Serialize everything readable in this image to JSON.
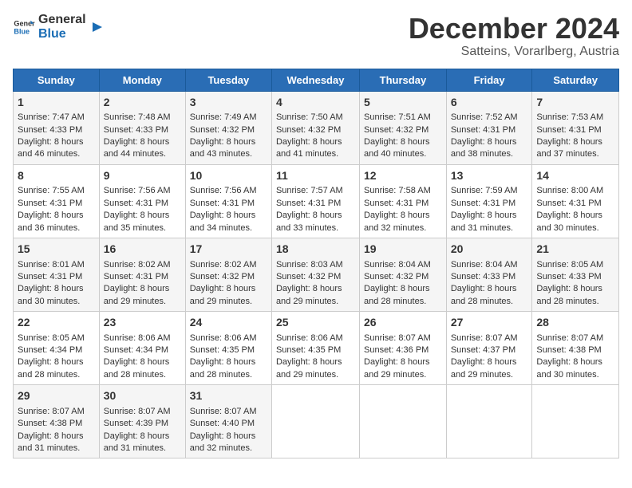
{
  "header": {
    "logo_general": "General",
    "logo_blue": "Blue",
    "month_title": "December 2024",
    "subtitle": "Satteins, Vorarlberg, Austria"
  },
  "days_of_week": [
    "Sunday",
    "Monday",
    "Tuesday",
    "Wednesday",
    "Thursday",
    "Friday",
    "Saturday"
  ],
  "weeks": [
    [
      {
        "day": "1",
        "sunrise": "Sunrise: 7:47 AM",
        "sunset": "Sunset: 4:33 PM",
        "daylight": "Daylight: 8 hours and 46 minutes."
      },
      {
        "day": "2",
        "sunrise": "Sunrise: 7:48 AM",
        "sunset": "Sunset: 4:33 PM",
        "daylight": "Daylight: 8 hours and 44 minutes."
      },
      {
        "day": "3",
        "sunrise": "Sunrise: 7:49 AM",
        "sunset": "Sunset: 4:32 PM",
        "daylight": "Daylight: 8 hours and 43 minutes."
      },
      {
        "day": "4",
        "sunrise": "Sunrise: 7:50 AM",
        "sunset": "Sunset: 4:32 PM",
        "daylight": "Daylight: 8 hours and 41 minutes."
      },
      {
        "day": "5",
        "sunrise": "Sunrise: 7:51 AM",
        "sunset": "Sunset: 4:32 PM",
        "daylight": "Daylight: 8 hours and 40 minutes."
      },
      {
        "day": "6",
        "sunrise": "Sunrise: 7:52 AM",
        "sunset": "Sunset: 4:31 PM",
        "daylight": "Daylight: 8 hours and 38 minutes."
      },
      {
        "day": "7",
        "sunrise": "Sunrise: 7:53 AM",
        "sunset": "Sunset: 4:31 PM",
        "daylight": "Daylight: 8 hours and 37 minutes."
      }
    ],
    [
      {
        "day": "8",
        "sunrise": "Sunrise: 7:55 AM",
        "sunset": "Sunset: 4:31 PM",
        "daylight": "Daylight: 8 hours and 36 minutes."
      },
      {
        "day": "9",
        "sunrise": "Sunrise: 7:56 AM",
        "sunset": "Sunset: 4:31 PM",
        "daylight": "Daylight: 8 hours and 35 minutes."
      },
      {
        "day": "10",
        "sunrise": "Sunrise: 7:56 AM",
        "sunset": "Sunset: 4:31 PM",
        "daylight": "Daylight: 8 hours and 34 minutes."
      },
      {
        "day": "11",
        "sunrise": "Sunrise: 7:57 AM",
        "sunset": "Sunset: 4:31 PM",
        "daylight": "Daylight: 8 hours and 33 minutes."
      },
      {
        "day": "12",
        "sunrise": "Sunrise: 7:58 AM",
        "sunset": "Sunset: 4:31 PM",
        "daylight": "Daylight: 8 hours and 32 minutes."
      },
      {
        "day": "13",
        "sunrise": "Sunrise: 7:59 AM",
        "sunset": "Sunset: 4:31 PM",
        "daylight": "Daylight: 8 hours and 31 minutes."
      },
      {
        "day": "14",
        "sunrise": "Sunrise: 8:00 AM",
        "sunset": "Sunset: 4:31 PM",
        "daylight": "Daylight: 8 hours and 30 minutes."
      }
    ],
    [
      {
        "day": "15",
        "sunrise": "Sunrise: 8:01 AM",
        "sunset": "Sunset: 4:31 PM",
        "daylight": "Daylight: 8 hours and 30 minutes."
      },
      {
        "day": "16",
        "sunrise": "Sunrise: 8:02 AM",
        "sunset": "Sunset: 4:31 PM",
        "daylight": "Daylight: 8 hours and 29 minutes."
      },
      {
        "day": "17",
        "sunrise": "Sunrise: 8:02 AM",
        "sunset": "Sunset: 4:32 PM",
        "daylight": "Daylight: 8 hours and 29 minutes."
      },
      {
        "day": "18",
        "sunrise": "Sunrise: 8:03 AM",
        "sunset": "Sunset: 4:32 PM",
        "daylight": "Daylight: 8 hours and 29 minutes."
      },
      {
        "day": "19",
        "sunrise": "Sunrise: 8:04 AM",
        "sunset": "Sunset: 4:32 PM",
        "daylight": "Daylight: 8 hours and 28 minutes."
      },
      {
        "day": "20",
        "sunrise": "Sunrise: 8:04 AM",
        "sunset": "Sunset: 4:33 PM",
        "daylight": "Daylight: 8 hours and 28 minutes."
      },
      {
        "day": "21",
        "sunrise": "Sunrise: 8:05 AM",
        "sunset": "Sunset: 4:33 PM",
        "daylight": "Daylight: 8 hours and 28 minutes."
      }
    ],
    [
      {
        "day": "22",
        "sunrise": "Sunrise: 8:05 AM",
        "sunset": "Sunset: 4:34 PM",
        "daylight": "Daylight: 8 hours and 28 minutes."
      },
      {
        "day": "23",
        "sunrise": "Sunrise: 8:06 AM",
        "sunset": "Sunset: 4:34 PM",
        "daylight": "Daylight: 8 hours and 28 minutes."
      },
      {
        "day": "24",
        "sunrise": "Sunrise: 8:06 AM",
        "sunset": "Sunset: 4:35 PM",
        "daylight": "Daylight: 8 hours and 28 minutes."
      },
      {
        "day": "25",
        "sunrise": "Sunrise: 8:06 AM",
        "sunset": "Sunset: 4:35 PM",
        "daylight": "Daylight: 8 hours and 29 minutes."
      },
      {
        "day": "26",
        "sunrise": "Sunrise: 8:07 AM",
        "sunset": "Sunset: 4:36 PM",
        "daylight": "Daylight: 8 hours and 29 minutes."
      },
      {
        "day": "27",
        "sunrise": "Sunrise: 8:07 AM",
        "sunset": "Sunset: 4:37 PM",
        "daylight": "Daylight: 8 hours and 29 minutes."
      },
      {
        "day": "28",
        "sunrise": "Sunrise: 8:07 AM",
        "sunset": "Sunset: 4:38 PM",
        "daylight": "Daylight: 8 hours and 30 minutes."
      }
    ],
    [
      {
        "day": "29",
        "sunrise": "Sunrise: 8:07 AM",
        "sunset": "Sunset: 4:38 PM",
        "daylight": "Daylight: 8 hours and 31 minutes."
      },
      {
        "day": "30",
        "sunrise": "Sunrise: 8:07 AM",
        "sunset": "Sunset: 4:39 PM",
        "daylight": "Daylight: 8 hours and 31 minutes."
      },
      {
        "day": "31",
        "sunrise": "Sunrise: 8:07 AM",
        "sunset": "Sunset: 4:40 PM",
        "daylight": "Daylight: 8 hours and 32 minutes."
      },
      null,
      null,
      null,
      null
    ]
  ]
}
